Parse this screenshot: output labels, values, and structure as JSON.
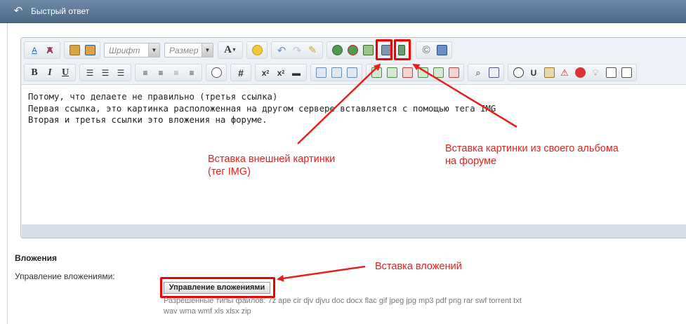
{
  "header": {
    "title": "Быстрый ответ"
  },
  "toolbar": {
    "font_placeholder": "Шрифт",
    "size_placeholder": "Размер",
    "text_a": "A",
    "bold": "B",
    "italic": "I",
    "underline": "U",
    "hash": "#",
    "sub": "x",
    "sup": "x"
  },
  "editor": {
    "line1": "Потому, что делаете не правильно (третья ссылка)",
    "line2": "Первая ссылка, это картинка расположенная на другом сервере вставляется с помощью тега IMG",
    "line3": "Вторая и третья ссылки это вложения на форуме."
  },
  "callouts": {
    "external_image_1": "Вставка внешней картинки",
    "external_image_2": "(тег IMG)",
    "album_image_1": "Вставка картинки из своего альбома",
    "album_image_2": "на форуме",
    "attachments": "Вставка вложений"
  },
  "attachments": {
    "section_title": "Вложения",
    "manage_label": "Управление вложениями:",
    "manage_button": "Управление вложениями",
    "allowed_types": "Разрешенные типы файлов: 7z ape cir djv djvu doc docx flac gif jpeg jpg mp3 pdf png rar swf torrent txt wav wma wmf xls xlsx zip"
  },
  "colors": {
    "header": "#5a7695",
    "callout": "#e8201c",
    "highlight": "#ee0000"
  }
}
